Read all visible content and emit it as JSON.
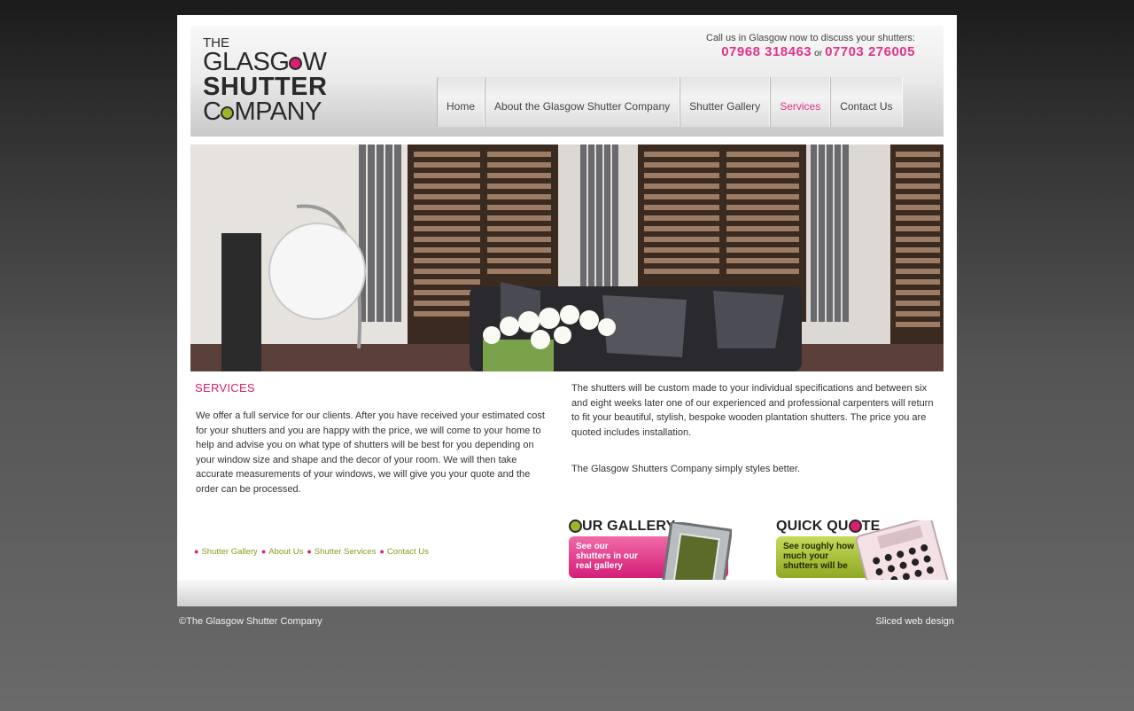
{
  "logo": {
    "line1": "THE",
    "line2": "GLASGOW",
    "line3": "SHUTTER",
    "line4": "COMPANY"
  },
  "call": {
    "text": "Call us in Glasgow now to discuss your shutters:",
    "phone1": "07968 318463",
    "or": "or",
    "phone2": "07703 276005"
  },
  "nav": {
    "items": [
      {
        "label": "Home"
      },
      {
        "label": "About the Glasgow Shutter Company"
      },
      {
        "label": "Shutter Gallery"
      },
      {
        "label": "Services"
      },
      {
        "label": "Contact Us"
      }
    ],
    "active": "Services"
  },
  "content": {
    "title": "SERVICES",
    "left": "We offer a full service for our clients. After you have received your estimated cost for your shutters and you are happy with the price, we will come to your home to help and advise you on what type of shutters will be best for you depending on your window size and shape and the decor of your room. We will then take accurate measurements of your windows, we will give you your quote and the order can be processed.",
    "right1": "The shutters will be custom made to your individual specifications and between six and eight weeks later one of our experienced and professional carpenters will return to fit your beautiful, stylish, bespoke wooden plantation shutters. The price you are quoted includes installation.",
    "right2": "The Glasgow Shutters Company simply styles better."
  },
  "footer_links": [
    {
      "label": "Shutter Gallery"
    },
    {
      "label": "About Us"
    },
    {
      "label": "Shutter Services"
    },
    {
      "label": "Contact Us"
    }
  ],
  "promos": {
    "gallery": {
      "title_rest": "UR GALLERY",
      "line1": "See our",
      "line2": "shutters in our",
      "line3": "real gallery"
    },
    "quote": {
      "title_pre": "QUICK QU",
      "title_post": "TE",
      "line1": "See roughly how",
      "line2": "much your",
      "line3": "shutters will be"
    }
  },
  "footer": {
    "copyright": "©The Glasgow Shutter Company",
    "credit": "Sliced web design"
  },
  "colors": {
    "accent_pink": "#e0338a",
    "accent_green": "#9bb62d"
  }
}
